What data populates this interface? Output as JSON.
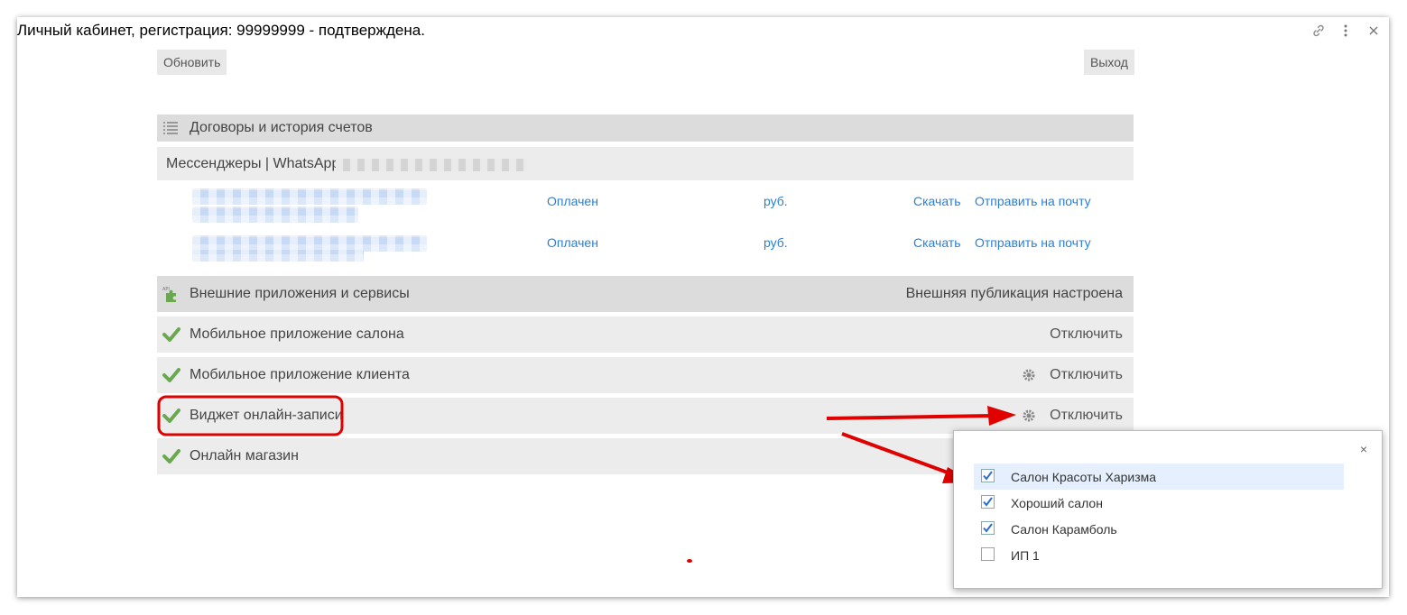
{
  "window": {
    "title": "Личный кабинет, регистрация: 99999999 - подтверждена.",
    "icons": [
      "link-icon",
      "more-vertical-icon",
      "close-icon"
    ]
  },
  "toolbar": {
    "refresh_label": "Обновить",
    "logout_label": "Выход"
  },
  "contracts": {
    "header": "Договоры и история счетов",
    "messenger_label": "Мессенджеры | WhatsApp",
    "invoices": [
      {
        "status": "Оплачен",
        "currency": "руб.",
        "download": "Скачать",
        "send": "Отправить на почту"
      },
      {
        "status": "Оплачен",
        "currency": "руб.",
        "download": "Скачать",
        "send": "Отправить на почту"
      }
    ]
  },
  "apps": {
    "header": "Внешние приложения и сервисы",
    "status": "Внешняя публикация настроена",
    "items": [
      {
        "label": "Мобильное приложение салона",
        "action": "Отключить"
      },
      {
        "label": "Мобильное приложение клиента",
        "action": "Отключить"
      },
      {
        "label": "Виджет онлайн-записи",
        "action": "Отключить"
      },
      {
        "label": "Онлайн магазин",
        "action": ""
      }
    ]
  },
  "popup": {
    "close_label": "×",
    "options": [
      {
        "label": "Салон Красоты Харизма",
        "checked": true
      },
      {
        "label": "Хороший салон",
        "checked": true
      },
      {
        "label": "Салон Карамболь",
        "checked": true
      },
      {
        "label": "ИП 1",
        "checked": false
      }
    ]
  },
  "colors": {
    "link": "#2a7fd4",
    "check": "#6aa84f",
    "annotation": "#e00000",
    "checkbox": "#2a6fd0"
  }
}
